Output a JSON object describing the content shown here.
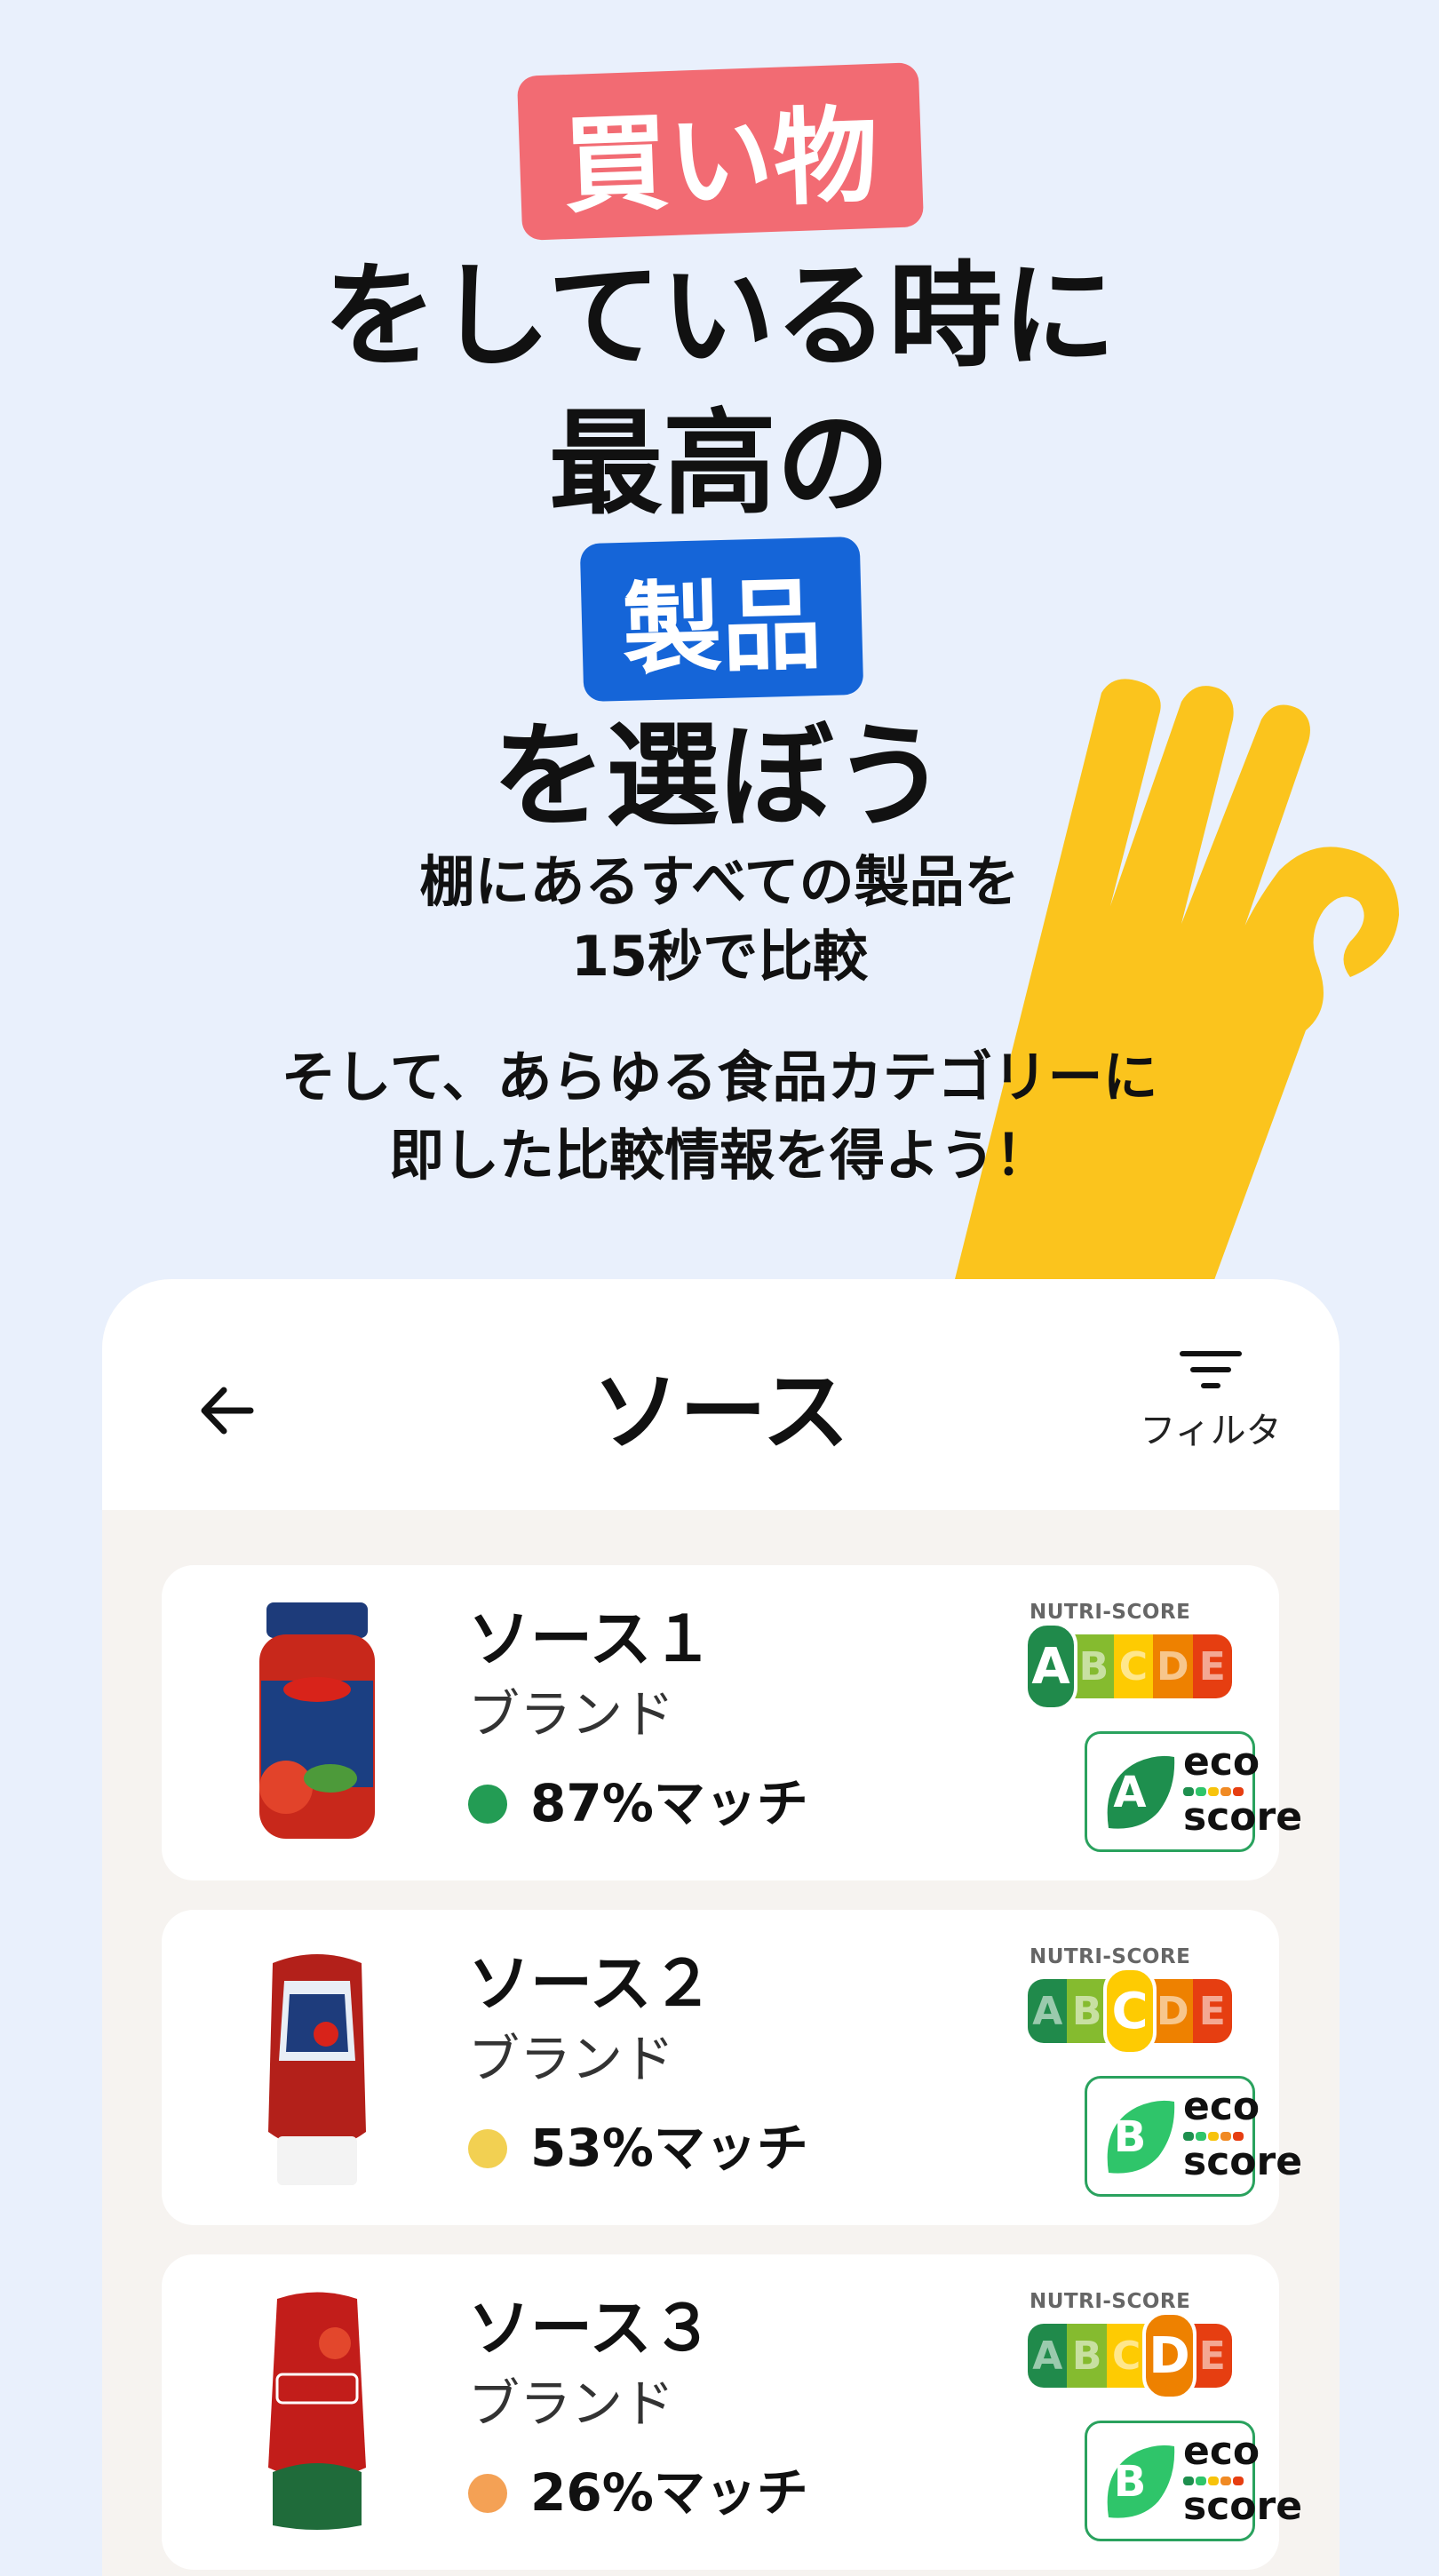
{
  "hero": {
    "tag_top": "買い物",
    "line1": "をしている時に",
    "line2": "最高の",
    "tag_middle": "製品",
    "line3": "を選ぼう",
    "sub1": "棚にあるすべての製品を",
    "sub2": "15秒で比較",
    "sub3": "そして、あらゆる食品カテゴリーに",
    "sub4": "即した比較情報を得よう！"
  },
  "app": {
    "title": "ソース",
    "back_icon": "arrow-left-icon",
    "filter_icon": "filter-icon",
    "filter_label": "フィルタ"
  },
  "nutri_label": "NUTRI-SCORE",
  "nutri_letters": [
    "A",
    "B",
    "C",
    "D",
    "E"
  ],
  "eco_words": [
    "eco",
    "score"
  ],
  "products": [
    {
      "name": "ソース１",
      "brand": "ブランド",
      "match": "87%マッチ",
      "match_color": "#239c54",
      "nutri": "A",
      "eco": "A",
      "eco_color": "#1e8f4e",
      "image": "basilico-sauce-jar"
    },
    {
      "name": "ソース２",
      "brand": "ブランド",
      "match": "53%マッチ",
      "match_color": "#f2d052",
      "nutri": "C",
      "eco": "B",
      "eco_color": "#2fc56a",
      "image": "heinz-ketchup-bottle"
    },
    {
      "name": "ソース３",
      "brand": "ブランド",
      "match": "26%マッチ",
      "match_color": "#f4a155",
      "nutri": "D",
      "eco": "B",
      "eco_color": "#2fc56a",
      "image": "amora-ketchup-bottle"
    }
  ],
  "colors": {
    "background": "#e9f0fc",
    "tag_red": "#f26b73",
    "tag_blue": "#1565d8",
    "hand": "#fbc41d",
    "nutri": [
      "#208a4b",
      "#85bb2f",
      "#fecb02",
      "#ee8100",
      "#e63e11"
    ]
  }
}
